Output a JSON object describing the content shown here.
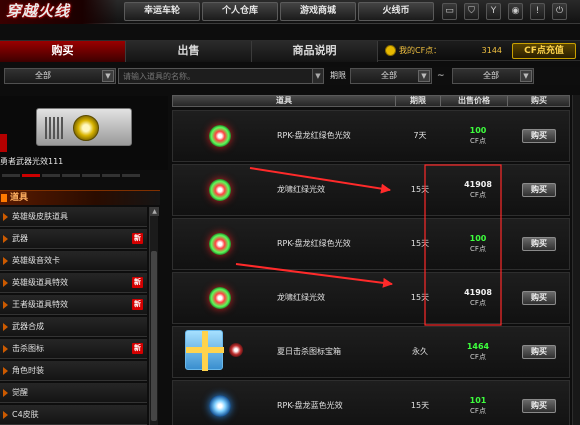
{
  "app": {
    "logo": "穿越火线",
    "top_nav": [
      "幸运车轮",
      "个人仓库",
      "游戏商城",
      "火线币"
    ],
    "top_icons": [
      {
        "icon": "tv-icon",
        "glyph": "▭"
      },
      {
        "icon": "shield-icon",
        "glyph": "⛉"
      },
      {
        "icon": "antenna-icon",
        "glyph": "Y"
      },
      {
        "icon": "location-pin-icon",
        "glyph": "◉"
      },
      {
        "icon": "info-icon",
        "glyph": "!"
      },
      {
        "icon": "power-icon",
        "glyph": "⏻"
      }
    ]
  },
  "tabs": [
    {
      "label": "购买",
      "active": true
    },
    {
      "label": "出售",
      "active": false
    },
    {
      "label": "商品说明",
      "active": false
    }
  ],
  "cf_points": {
    "label": "我的CF点：",
    "value": "3144",
    "recharge_label": "CF点充值"
  },
  "filters": {
    "category": "全部",
    "search_placeholder": "请输入道具的名称。",
    "period_label": "期限",
    "period_from": "全部",
    "tilde": "~",
    "period_to": "全部",
    "dropdown_arrow": "▼",
    "search_arrow": "▼"
  },
  "preview": {
    "name": "勇者武器光效111"
  },
  "sidebar": {
    "header": "道具",
    "new_badge": "新",
    "scroll_up": "▲",
    "items": [
      {
        "label": "英雄级皮肤道具",
        "new": false
      },
      {
        "label": "武器",
        "new": true
      },
      {
        "label": "英雄级音效卡",
        "new": false
      },
      {
        "label": "英雄级道具特效",
        "new": true
      },
      {
        "label": "王者级道具特效",
        "new": true
      },
      {
        "label": "武器合成",
        "new": false
      },
      {
        "label": "击杀图标",
        "new": true
      },
      {
        "label": "角色时装",
        "new": false
      },
      {
        "label": "觉醒",
        "new": false
      },
      {
        "label": "C4皮肤",
        "new": false
      }
    ]
  },
  "table": {
    "headers": [
      "道具",
      "期限",
      "出售价格",
      "购买"
    ],
    "buy_label": "购买",
    "rows": [
      {
        "name": "RPK-盘龙红绿色光效",
        "period": "7天",
        "price": "100",
        "unit": "CF点",
        "color": "green",
        "icon": "red-green-gem-icon"
      },
      {
        "name": "龙啸红绿光效",
        "period": "15天",
        "price": "41908",
        "unit": "CF点",
        "color": "white",
        "icon": "red-green-gem-icon"
      },
      {
        "name": "RPK-盘龙红绿色光效",
        "period": "15天",
        "price": "100",
        "unit": "CF点",
        "color": "green",
        "icon": "red-green-gem-icon"
      },
      {
        "name": "龙啸红绿光效",
        "period": "15天",
        "price": "41908",
        "unit": "CF点",
        "color": "white",
        "icon": "red-green-gem-icon"
      },
      {
        "name": "夏日击杀图标宝箱",
        "period": "永久",
        "price": "1464",
        "unit": "CF点",
        "color": "green",
        "icon": "gift-box-icon"
      },
      {
        "name": "RPK-盘龙蓝色光效",
        "period": "15天",
        "price": "101",
        "unit": "CF点",
        "color": "green",
        "icon": "blue-gem-icon"
      }
    ]
  },
  "colors": {
    "annotation": "#ff2a2a",
    "accent_red": "#cc0000",
    "price_green": "#3dff3d",
    "cf_gold": "#f0c040"
  }
}
